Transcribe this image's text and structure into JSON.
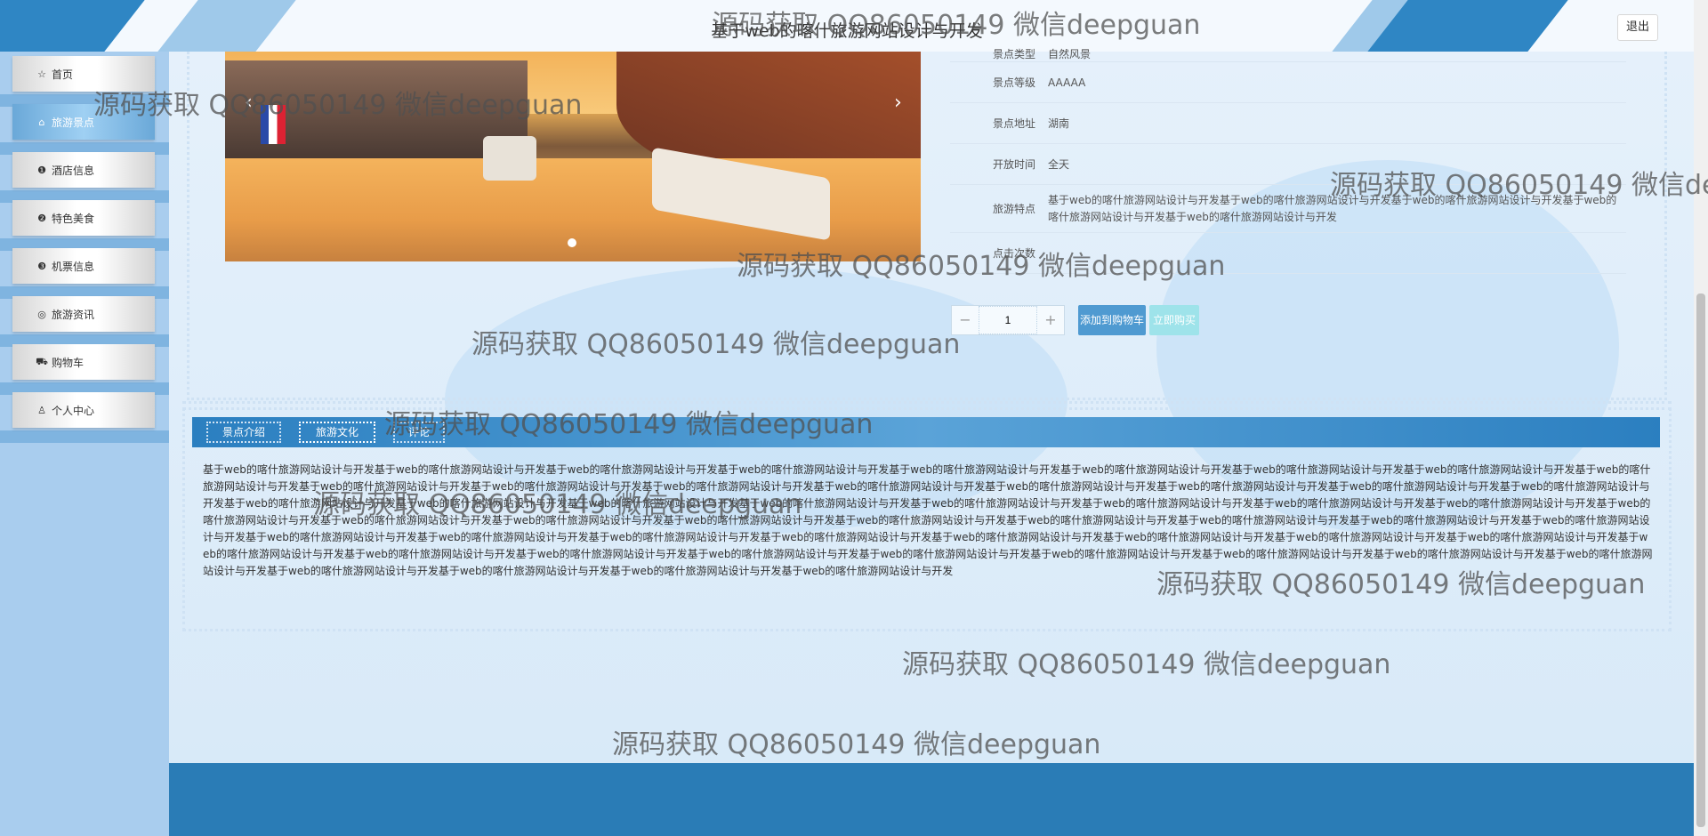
{
  "header": {
    "title": "基于web的喀什旅游网站设计与开发",
    "logout_label": "退出"
  },
  "sidebar": {
    "items": [
      {
        "label": "首页",
        "icon": "star-icon",
        "active": false
      },
      {
        "label": "旅游景点",
        "icon": "home-icon",
        "active": true
      },
      {
        "label": "酒店信息",
        "icon": "info-circle-icon",
        "active": false
      },
      {
        "label": "特色美食",
        "icon": "question-circle-icon",
        "active": false
      },
      {
        "label": "机票信息",
        "icon": "info-icon",
        "active": false
      },
      {
        "label": "旅游资讯",
        "icon": "globe-icon",
        "active": false
      },
      {
        "label": "购物车",
        "icon": "cart-icon",
        "active": false
      },
      {
        "label": "个人中心",
        "icon": "user-icon",
        "active": false
      }
    ]
  },
  "detail": {
    "rows": [
      {
        "label": "景点类型",
        "value": "自然风景"
      },
      {
        "label": "景点等级",
        "value": "AAAAA"
      },
      {
        "label": "景点地址",
        "value": "湖南"
      },
      {
        "label": "开放时间",
        "value": "全天"
      },
      {
        "label": "旅游特点",
        "value": "基于web的喀什旅游网站设计与开发基于web的喀什旅游网站设计与开发基于web的喀什旅游网站设计与开发基于web的喀什旅游网站设计与开发基于web的喀什旅游网站设计与开发"
      },
      {
        "label": "点击次数",
        "value": ""
      }
    ],
    "quantity": "1",
    "minus_label": "−",
    "plus_label": "+",
    "add_cart_label": "添加到购物车",
    "buy_now_label": "立即购买",
    "carousel_prev": "‹",
    "carousel_next": "›"
  },
  "tabs": [
    {
      "label": "景点介绍",
      "active": false
    },
    {
      "label": "旅游文化",
      "active": true
    },
    {
      "label": "评论",
      "active": false
    }
  ],
  "content_text": "基于web的喀什旅游网站设计与开发基于web的喀什旅游网站设计与开发基于web的喀什旅游网站设计与开发基于web的喀什旅游网站设计与开发基于web的喀什旅游网站设计与开发基于web的喀什旅游网站设计与开发基于web的喀什旅游网站设计与开发基于web的喀什旅游网站设计与开发基于web的喀什旅游网站设计与开发基于web的喀什旅游网站设计与开发基于web的喀什旅游网站设计与开发基于web的喀什旅游网站设计与开发基于web的喀什旅游网站设计与开发基于web的喀什旅游网站设计与开发基于web的喀什旅游网站设计与开发基于web的喀什旅游网站设计与开发基于web的喀什旅游网站设计与开发基于web的喀什旅游网站设计与开发基于web的喀什旅游网站设计与开发基于web的喀什旅游网站设计与开发基于web的喀什旅游网站设计与开发基于web的喀什旅游网站设计与开发基于web的喀什旅游网站设计与开发基于web的喀什旅游网站设计与开发基于web的喀什旅游网站设计与开发基于web的喀什旅游网站设计与开发基于web的喀什旅游网站设计与开发基于web的喀什旅游网站设计与开发基于web的喀什旅游网站设计与开发基于web的喀什旅游网站设计与开发基于web的喀什旅游网站设计与开发基于web的喀什旅游网站设计与开发基于web的喀什旅游网站设计与开发基于web的喀什旅游网站设计与开发基于web的喀什旅游网站设计与开发基于web的喀什旅游网站设计与开发基于web的喀什旅游网站设计与开发基于web的喀什旅游网站设计与开发基于web的喀什旅游网站设计与开发基于web的喀什旅游网站设计与开发基于web的喀什旅游网站设计与开发基于web的喀什旅游网站设计与开发基于web的喀什旅游网站设计与开发基于web的喀什旅游网站设计与开发基于web的喀什旅游网站设计与开发基于web的喀什旅游网站设计与开发基于web的喀什旅游网站设计与开发基于web的喀什旅游网站设计与开发基于web的喀什旅游网站设计与开发基于web的喀什旅游网站设计与开发基于web的喀什旅游网站设计与开发基于web的喀什旅游网站设计与开发基于web的喀什旅游网站设计与开发基于web的喀什旅游网站设计与开发基于web的喀什旅游网站设计与开发",
  "watermark_text": "源码获取 QQ86050149 微信deepguan"
}
